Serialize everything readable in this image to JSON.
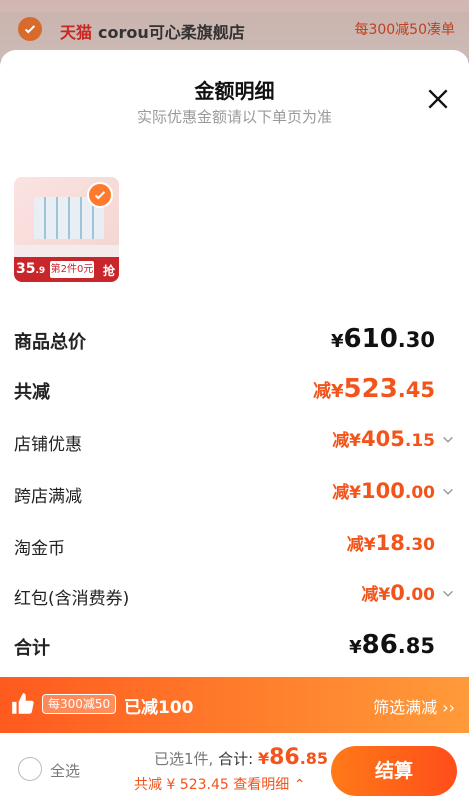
{
  "store": {
    "brand_tag": "天猫",
    "name": "corou可心柔旗舰店",
    "promo": "每300减50凑单"
  },
  "sheet": {
    "title": "金额明细",
    "subtitle": "实际优惠金额请以下单页为准"
  },
  "product": {
    "price_int": "35",
    "price_dec": ".9",
    "deal": "第2件0元",
    "grab": "抢"
  },
  "rows": {
    "total_label": "商品总价",
    "total_int": "610",
    "total_dec": ".30",
    "reduce_label": "共减",
    "reduce_int": "523",
    "reduce_dec": ".45",
    "shop_label": "店铺优惠",
    "shop_int": "405",
    "shop_dec": ".15",
    "cross_label": "跨店满减",
    "cross_int": "100",
    "cross_dec": ".00",
    "coin_label": "淘金币",
    "coin_int": "18",
    "coin_dec": ".30",
    "packet_label": "红包(含消费券)",
    "packet_int": "0",
    "packet_dec": ".00",
    "sum_label": "合计",
    "sum_int": "86",
    "sum_dec": ".85"
  },
  "promo_bar": {
    "pill": "每300减50",
    "text": "已减100",
    "filter": "筛选满减 ››"
  },
  "footer": {
    "select_all": "全选",
    "selected": "已选1件,",
    "total_label": "合计:",
    "currency": "¥",
    "amount_int": "86",
    "amount_dec": ".85",
    "discount_text": "共减 ¥ 523.45",
    "detail_text": "查看明细",
    "checkout": "结算"
  },
  "colors": {
    "accent": "#f2541b",
    "tmall_red": "#c9271f"
  }
}
